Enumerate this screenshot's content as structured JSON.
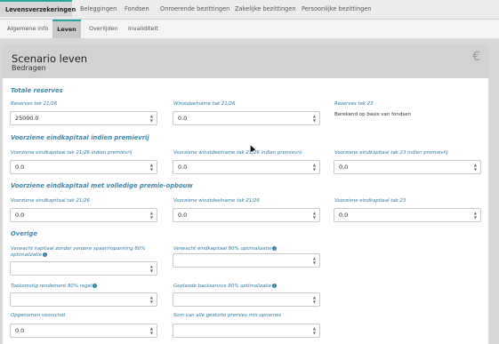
{
  "tabs": [
    "Levensverzekeringen",
    "Beleggingen",
    "Fondsen",
    "Onroerende bezittingen",
    "Zakelijke bezittingen",
    "Persoonlijke bezittingen"
  ],
  "subtabs": [
    "Algemene info",
    "Leven",
    "Overlijden",
    "Invaliditeit"
  ],
  "header": {
    "title": "Scenario leven",
    "subtitle": "Bedragen",
    "currency_icon": "€"
  },
  "sections": {
    "totale_reserves": {
      "title": "Totale reserves",
      "reserves_tak_21_26": {
        "label": "Reserves tak 21/26",
        "value": "25000.0"
      },
      "winstdeelname_tak_21_26": {
        "label": "Winstdeelname tak 21/26",
        "value": "0.0"
      },
      "reserves_tak_23": {
        "label": "Reserves tak 23",
        "text": "Berekend op basis van fondsen"
      }
    },
    "premievrij": {
      "title": "Voorziene eindkapitaal indien premievrij",
      "f1": {
        "label": "Voorziene eindkapitaal tak 21/26 indien premievrij",
        "value": "0.0"
      },
      "f2": {
        "label": "Voorziene winstdeelname tak 21/26 indien premievrij",
        "value": "0.0"
      },
      "f3": {
        "label": "Voorziene eindkapitaal tak 23 indien premievrij",
        "value": "0.0"
      }
    },
    "volledige": {
      "title": "Voorziene eindkapitaal met volledige premie-opbouw",
      "f1": {
        "label": "Voorziene eindkapitaal tak 21/26",
        "value": "0.0"
      },
      "f2": {
        "label": "Voorziene winstdeelname tak 21/26",
        "value": "0.0"
      },
      "f3": {
        "label": "Voorziene eindkapitaal tak 23",
        "value": "0.0"
      }
    },
    "overige": {
      "title": "Overige",
      "verwacht_zonder_l1": "Verwacht kapitaal zonder verdere spaarinspanning 80%",
      "verwacht_zonder_l2": "optimalizatie",
      "verwacht_eind": "Verwacht eindkapitaal 80% optimalizatie",
      "toekomstig": "Toekomstig rendement 80% regel",
      "geplande": "Geplande backservice 80% optimalizatie",
      "opgenomen": {
        "label": "Opgenomen voorschot",
        "value": "0.0"
      },
      "som": "Som van alle gestorte premies min opnames"
    }
  },
  "colors": {
    "accent": "#2aa5a1",
    "label": "#2a7aa3",
    "section": "#3e86a8"
  }
}
